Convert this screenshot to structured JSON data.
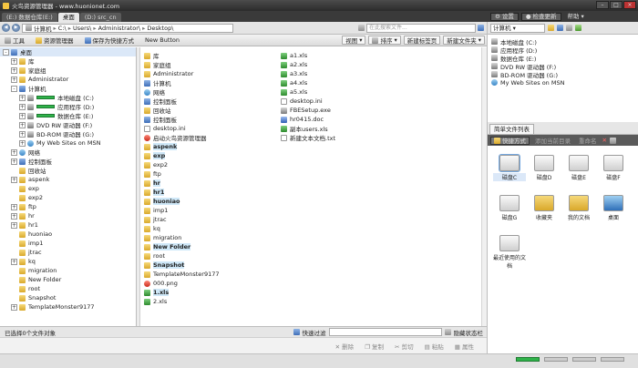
{
  "window": {
    "title": "火鸟资源管理器 - www.huonionet.com"
  },
  "tabs": [
    {
      "label": "(E:) 数据仓库(E:)",
      "active": false
    },
    {
      "label": "桌面",
      "active": true
    },
    {
      "label": "(D:) src_cn",
      "active": false
    }
  ],
  "address": {
    "crumbs": [
      "计算机",
      "C:\\",
      "Users\\",
      "Administrator\\",
      "Desktop\\"
    ],
    "search_placeholder": "在此搜索文件..."
  },
  "toolbar": {
    "tools": "工具",
    "explorer": "资源管理器",
    "save_shortcut": "保存为快捷方式",
    "new_button": "New Button",
    "view": "视图",
    "sort": "排序",
    "new_tab": "新建标签页",
    "new_folder": "新建文件夹"
  },
  "tree": [
    {
      "label": "桌面",
      "icon": "desktop-icon",
      "indent": 0,
      "exp": "-"
    },
    {
      "label": "库",
      "icon": "library-icon",
      "indent": 1,
      "exp": "+"
    },
    {
      "label": "家庭组",
      "icon": "homegroup-icon",
      "indent": 1,
      "exp": "+"
    },
    {
      "label": "Administrator",
      "icon": "user-folder-icon",
      "indent": 1,
      "exp": "+"
    },
    {
      "label": "计算机",
      "icon": "computer-icon",
      "indent": 1,
      "exp": "-"
    },
    {
      "label": "本地磁盘 (C:)",
      "icon": "drive-icon",
      "indent": 2,
      "exp": "+",
      "bar": true
    },
    {
      "label": "应用程序 (D:)",
      "icon": "drive-icon",
      "indent": 2,
      "exp": "+",
      "bar": true
    },
    {
      "label": "数据仓库 (E:)",
      "icon": "drive-icon",
      "indent": 2,
      "exp": "+",
      "bar": true
    },
    {
      "label": "DVD RW 驱动器 (F:)",
      "icon": "dvd-icon",
      "indent": 2,
      "exp": "+"
    },
    {
      "label": "BD-ROM 驱动器 (G:)",
      "icon": "bdrom-icon",
      "indent": 2,
      "exp": "+"
    },
    {
      "label": "My Web Sites on MSN",
      "icon": "web-icon",
      "indent": 2,
      "exp": "+"
    },
    {
      "label": "网络",
      "icon": "network-icon",
      "indent": 1,
      "exp": "+"
    },
    {
      "label": "控制面板",
      "icon": "control-panel-icon",
      "indent": 1,
      "exp": "+"
    },
    {
      "label": "回收站",
      "icon": "recycle-bin-icon",
      "indent": 1,
      "exp": ""
    },
    {
      "label": "aspenk",
      "icon": "folder-icon",
      "indent": 1,
      "exp": "+"
    },
    {
      "label": "exp",
      "icon": "folder-icon",
      "indent": 1,
      "exp": ""
    },
    {
      "label": "exp2",
      "icon": "folder-icon",
      "indent": 1,
      "exp": ""
    },
    {
      "label": "ftp",
      "icon": "folder-icon",
      "indent": 1,
      "exp": "+"
    },
    {
      "label": "hr",
      "icon": "folder-icon",
      "indent": 1,
      "exp": "+"
    },
    {
      "label": "hr1",
      "icon": "folder-icon",
      "indent": 1,
      "exp": "+"
    },
    {
      "label": "huoniao",
      "icon": "folder-icon",
      "indent": 1,
      "exp": ""
    },
    {
      "label": "imp1",
      "icon": "folder-icon",
      "indent": 1,
      "exp": ""
    },
    {
      "label": "jtrac",
      "icon": "folder-icon",
      "indent": 1,
      "exp": ""
    },
    {
      "label": "kq",
      "icon": "folder-icon",
      "indent": 1,
      "exp": "+"
    },
    {
      "label": "migration",
      "icon": "folder-icon",
      "indent": 1,
      "exp": ""
    },
    {
      "label": "New Folder",
      "icon": "folder-icon",
      "indent": 1,
      "exp": ""
    },
    {
      "label": "root",
      "icon": "folder-icon",
      "indent": 1,
      "exp": ""
    },
    {
      "label": "Snapshot",
      "icon": "folder-icon",
      "indent": 1,
      "exp": ""
    },
    {
      "label": "TemplateMonster9177",
      "icon": "folder-icon",
      "indent": 1,
      "exp": "+"
    }
  ],
  "files_col1": [
    {
      "name": "库",
      "icon": "library-icon",
      "hl": false
    },
    {
      "name": "家庭组",
      "icon": "homegroup-icon",
      "hl": false
    },
    {
      "name": "Administrator",
      "icon": "user-folder-icon",
      "hl": false
    },
    {
      "name": "计算机",
      "icon": "computer-icon",
      "hl": false
    },
    {
      "name": "网络",
      "icon": "network-icon",
      "hl": false
    },
    {
      "name": "控制面板",
      "icon": "control-panel-icon",
      "hl": false
    },
    {
      "name": "回收站",
      "icon": "recycle-bin-icon",
      "hl": false
    },
    {
      "name": "控制面板",
      "icon": "control-panel-icon",
      "hl": false
    },
    {
      "name": "desktop.ini",
      "icon": "ini-file-icon",
      "hl": false
    },
    {
      "name": "启动火鸟资源管理器",
      "icon": "app-icon",
      "hl": false
    },
    {
      "name": "aspenk",
      "icon": "folder-icon",
      "hl": true
    },
    {
      "name": "exp",
      "icon": "folder-icon",
      "hl": true
    },
    {
      "name": "exp2",
      "icon": "folder-icon",
      "hl": false
    },
    {
      "name": "ftp",
      "icon": "folder-icon",
      "hl": false
    },
    {
      "name": "hr",
      "icon": "folder-icon",
      "hl": true
    },
    {
      "name": "hr1",
      "icon": "folder-icon",
      "hl": true
    },
    {
      "name": "huoniao",
      "icon": "folder-icon",
      "hl": true
    },
    {
      "name": "imp1",
      "icon": "folder-icon",
      "hl": false
    },
    {
      "name": "jtrac",
      "icon": "folder-icon",
      "hl": false
    },
    {
      "name": "kq",
      "icon": "folder-icon",
      "hl": false
    },
    {
      "name": "migration",
      "icon": "folder-icon",
      "hl": false
    },
    {
      "name": "New Folder",
      "icon": "folder-icon",
      "hl": true
    },
    {
      "name": "root",
      "icon": "folder-icon",
      "hl": false
    },
    {
      "name": "Snapshot",
      "icon": "folder-icon",
      "hl": true
    },
    {
      "name": "TemplateMonster9177",
      "icon": "folder-icon",
      "hl": false
    },
    {
      "name": "000.png",
      "icon": "image-file-icon",
      "hl": false
    },
    {
      "name": "1.xls",
      "icon": "xls-file-icon",
      "hl": true
    },
    {
      "name": "2.xls",
      "icon": "xls-file-icon",
      "hl": false
    }
  ],
  "files_col2": [
    {
      "name": "a1.xls",
      "icon": "xls-file-icon",
      "hl": false
    },
    {
      "name": "a2.xls",
      "icon": "xls-file-icon",
      "hl": false
    },
    {
      "name": "a3.xls",
      "icon": "xls-file-icon",
      "hl": false
    },
    {
      "name": "a4.xls",
      "icon": "xls-file-icon",
      "hl": false
    },
    {
      "name": "a5.xls",
      "icon": "xls-file-icon",
      "hl": false
    },
    {
      "name": "desktop.ini",
      "icon": "ini-file-icon",
      "hl": false
    },
    {
      "name": "FBESetup.exe",
      "icon": "exe-file-icon",
      "hl": false
    },
    {
      "name": "hr0415.doc",
      "icon": "doc-file-icon",
      "hl": false
    },
    {
      "name": "副本users.xls",
      "icon": "xls-file-icon",
      "hl": false
    },
    {
      "name": "新建文本文档.txt",
      "icon": "txt-file-icon",
      "hl": false
    }
  ],
  "status": {
    "selected": "已选择0个文件对象",
    "quick_filter": "快速过滤",
    "hide_status": "隐藏状态栏"
  },
  "actions": [
    "删除",
    "复制",
    "剪切",
    "粘贴",
    "属性"
  ],
  "right": {
    "settings": "设置",
    "check_update": "检查更新",
    "help": "帮助",
    "drive_select": "计算机",
    "drives": [
      {
        "name": "本地磁盘 (C:)",
        "icon": "drive-icon"
      },
      {
        "name": "应用程序 (D:)",
        "icon": "drive-icon"
      },
      {
        "name": "数据仓库 (E:)",
        "icon": "drive-icon"
      },
      {
        "name": "DVD RW 驱动器 (F:)",
        "icon": "dvd-icon"
      },
      {
        "name": "BD-ROM 驱动器 (G:)",
        "icon": "bdrom-icon"
      },
      {
        "name": "My Web Sites on MSN",
        "icon": "web-icon"
      }
    ],
    "simple_list_tab": "简单文件列表",
    "shortcut_mode": "快捷方式",
    "add_current": "添加当前目录",
    "rename": "重命名",
    "shortcuts": [
      {
        "label": "磁盘C",
        "icon": "drive-icon",
        "kind": "drive"
      },
      {
        "label": "磁盘D",
        "icon": "drive-icon",
        "kind": "drive"
      },
      {
        "label": "磁盘E",
        "icon": "drive-icon",
        "kind": "drive"
      },
      {
        "label": "磁盘F",
        "icon": "drive-icon",
        "kind": "drive"
      },
      {
        "label": "磁盘G",
        "icon": "drive-icon",
        "kind": "drive"
      },
      {
        "label": "收藏夹",
        "icon": "favorites-icon",
        "kind": "fold"
      },
      {
        "label": "我的文档",
        "icon": "documents-icon",
        "kind": "fold"
      },
      {
        "label": "桌面",
        "icon": "desktop-icon",
        "kind": "desk"
      },
      {
        "label": "最近使用的文档",
        "icon": "recent-docs-icon",
        "kind": "drive"
      }
    ]
  }
}
